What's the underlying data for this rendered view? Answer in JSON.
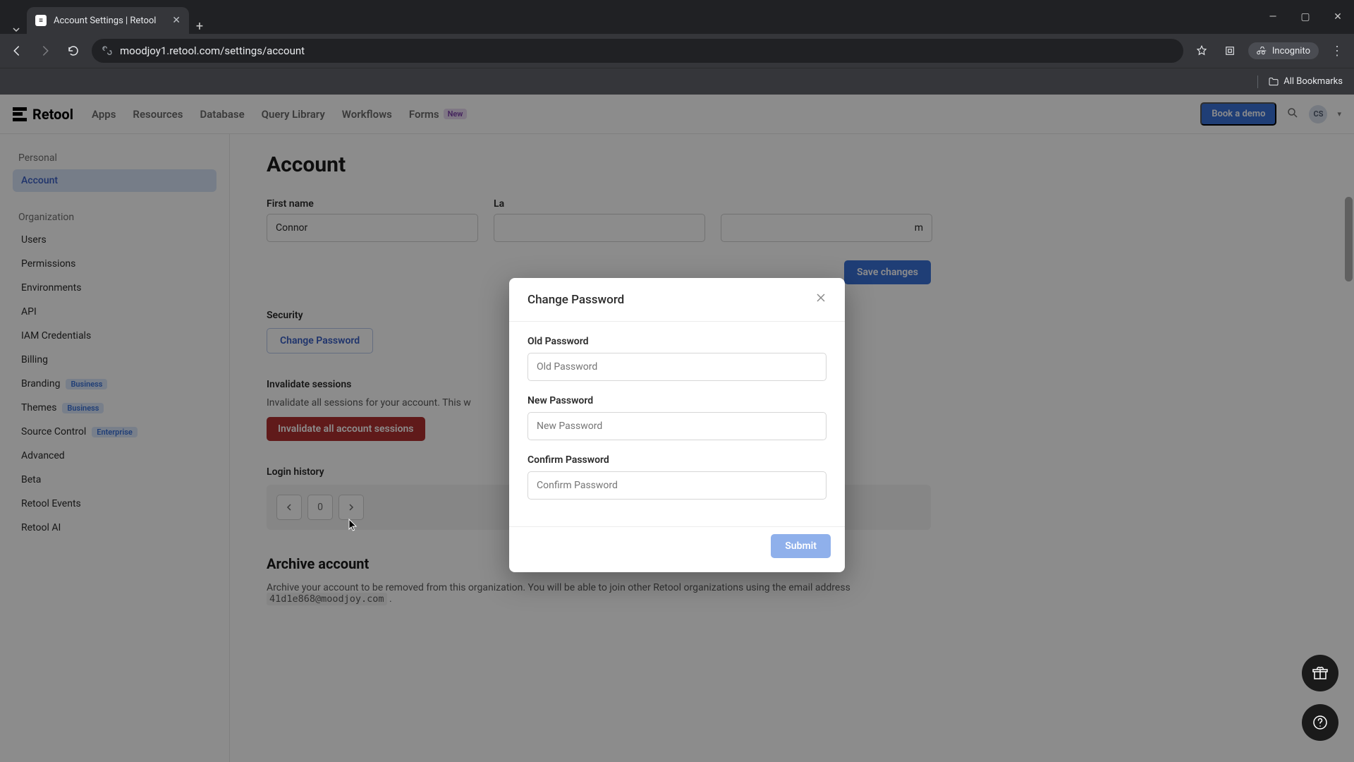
{
  "browser": {
    "tab_title": "Account Settings | Retool",
    "url": "moodjoy1.retool.com/settings/account",
    "incognito_label": "Incognito",
    "all_bookmarks": "All Bookmarks"
  },
  "header": {
    "brand": "Retool",
    "nav": {
      "apps": "Apps",
      "resources": "Resources",
      "database": "Database",
      "query_library": "Query Library",
      "workflows": "Workflows",
      "forms": "Forms",
      "forms_badge": "New"
    },
    "book_demo": "Book a demo",
    "avatar_initials": "CS"
  },
  "sidebar": {
    "personal_label": "Personal",
    "organization_label": "Organization",
    "items": {
      "account": "Account",
      "users": "Users",
      "permissions": "Permissions",
      "environments": "Environments",
      "api": "API",
      "iam": "IAM Credentials",
      "billing": "Billing",
      "branding": "Branding",
      "themes": "Themes",
      "source_control": "Source Control",
      "advanced": "Advanced",
      "beta": "Beta",
      "retool_events": "Retool Events",
      "retool_ai": "Retool AI"
    },
    "badges": {
      "business": "Business",
      "enterprise": "Enterprise"
    }
  },
  "page": {
    "title": "Account",
    "first_name_label": "First name",
    "first_name_value": "Connor",
    "last_name_label": "La",
    "email_partial": "m",
    "save_changes": "Save changes",
    "security_label": "Security",
    "change_password_btn": "Change Password",
    "invalidate_title": "Invalidate sessions",
    "invalidate_desc": "Invalidate all sessions for your account. This w",
    "invalidate_btn": "Invalidate all account sessions",
    "login_history": "Login history",
    "page_number": "0",
    "archive_title": "Archive account",
    "archive_desc_1": "Archive your account to be removed from this organization. You will be able to join other Retool organizations using the email address ",
    "archive_email": "41d1e868@moodjoy.com",
    "archive_desc_2": " ."
  },
  "modal": {
    "title": "Change Password",
    "old_label": "Old Password",
    "old_placeholder": "Old Password",
    "new_label": "New Password",
    "new_placeholder": "New Password",
    "confirm_label": "Confirm Password",
    "confirm_placeholder": "Confirm Password",
    "submit": "Submit"
  }
}
